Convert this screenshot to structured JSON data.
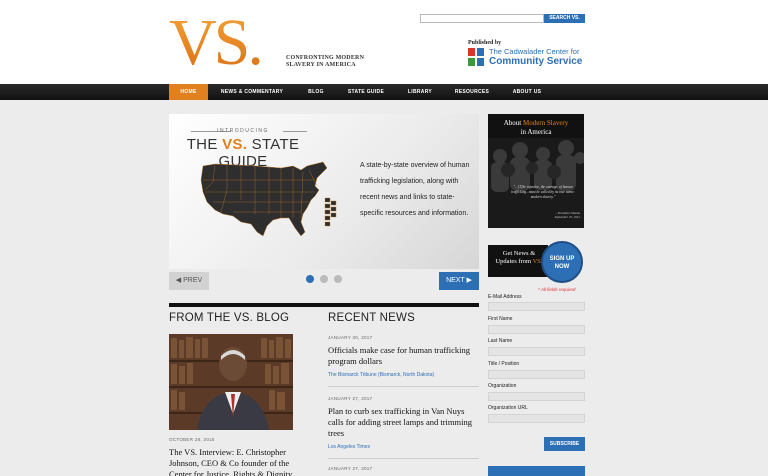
{
  "header": {
    "logo_text": "VS.",
    "tagline_line1": "CONFRONTING MODERN",
    "tagline_line2": "SLAVERY IN AMERICA",
    "search_button": "SEARCH VS.",
    "search_placeholder": "",
    "published_by": "Published by",
    "publisher_line1": "The Cadwalader Center for",
    "publisher_line2": "Community Service"
  },
  "nav": {
    "items": [
      "HOME",
      "NEWS & COMMENTARY",
      "BLOG",
      "STATE GUIDE",
      "LIBRARY",
      "RESOURCES",
      "ABOUT US"
    ],
    "active_index": 0
  },
  "hero": {
    "intro": "INTRODUCING",
    "title_pre": "THE ",
    "title_vs": "VS.",
    "title_post": " STATE GUIDE",
    "description": "A state-by-state overview of human trafficking legislation, along with recent news and links to state-specific resources and information.",
    "prev_label": "◀ PREV",
    "next_label": "NEXT ▶",
    "slide_count": 3,
    "active_slide": 1
  },
  "blog": {
    "heading": "FROM THE VS. BLOG",
    "date": "OCTOBER 28, 2015",
    "title": "The VS. Interview: E. Christopher Johnson, CEO & Co founder of the Center for Justice, Rights & Dignity"
  },
  "news": {
    "heading": "RECENT NEWS",
    "items": [
      {
        "date": "JANUARY 30, 2017",
        "title": "Officials make case for human trafficking program dollars",
        "source": "The Bismarck Tribune (Bismarck, North Dakota)"
      },
      {
        "date": "JANUARY 27, 2017",
        "title": "Plan to curb sex trafficking in Van Nuys calls for adding street lamps and trimming trees",
        "source": "Los Angeles Times"
      },
      {
        "date": "JANUARY 27, 2017",
        "title": "",
        "source": ""
      }
    ]
  },
  "sidebar": {
    "about_pre": "About ",
    "about_highlight": "Modern Slavery",
    "about_post": "in America",
    "quote": "\"...[T]he injustice, the outrage, of human trafficking...must be called by its true name: modern slavery.\"",
    "quote_author": "– President Obama",
    "quote_date": "September 25, 2012",
    "signup_pre": "Get News & Updates from",
    "signup_vs": "VS.",
    "signup_button_line1": "SIGN UP",
    "signup_button_line2": "NOW",
    "required_note": "* All fields required",
    "fields": [
      "E-Mail Address",
      "First Name",
      "Last Name",
      "Title / Position",
      "Organization",
      "Organization URL"
    ],
    "subscribe_label": "SUBSCRIBE"
  },
  "colors": {
    "accent": "#e0801e",
    "brand_blue": "#2d6fb5",
    "nav_bg": "#1a1a1a"
  }
}
